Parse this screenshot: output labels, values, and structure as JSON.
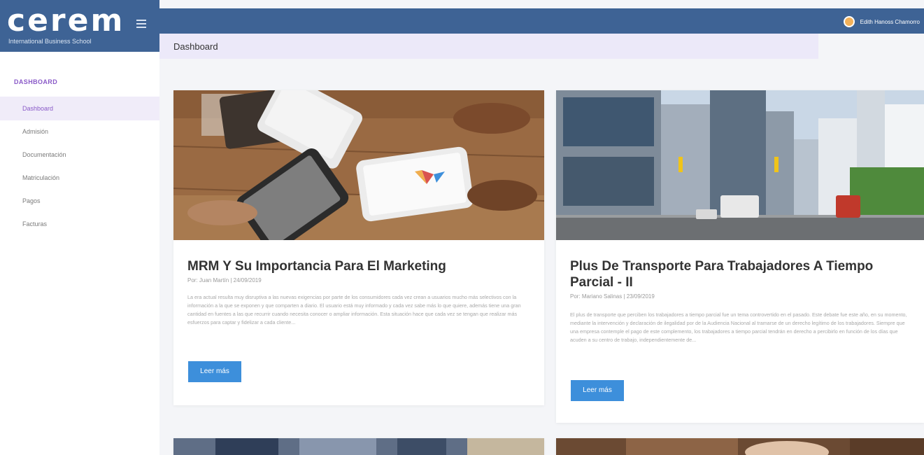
{
  "brand": {
    "name": "cerem",
    "subtitle": "International Business School"
  },
  "sidebar": {
    "section_title": "DASHBOARD",
    "items": [
      {
        "label": "Dashboard",
        "active": true
      },
      {
        "label": "Admisión",
        "active": false
      },
      {
        "label": "Documentación",
        "active": false
      },
      {
        "label": "Matriculación",
        "active": false
      },
      {
        "label": "Pagos",
        "active": false
      },
      {
        "label": "Facturas",
        "active": false
      }
    ]
  },
  "topbar": {
    "user_name": "Edith Hanoss Chamorro"
  },
  "page": {
    "title": "Dashboard"
  },
  "posts": [
    {
      "title": "MRM Y Su Importancia Para El Marketing",
      "meta": "Por: Juan Martín | 24/09/2019",
      "excerpt": "La era actual resulta muy disruptiva a las nuevas exigencias por parte de los consumidores cada vez crean a usuarios mucho más selectivos con la información a la que se exponen y que comparten a diario. El usuario está muy informado y cada vez sabe más lo que quiere, además tiene una gran cantidad en fuentes a las que recurrir cuando necesita conocer o ampliar información. Esta situación hace que cada vez se tengan que realizar más esfuerzos para captar y fidelizar a cada cliente...",
      "button": "Leer más"
    },
    {
      "title": "Plus De Transporte Para Trabajadores A Tiempo Parcial - II",
      "meta": "Por: Mariano Salinas | 23/09/2019",
      "excerpt": "El plus de transporte que perciben los trabajadores a tiempo parcial fue un tema controvertido en el pasado. Este debate fue este año, en su momento, mediante la intervención y declaración de ilegalidad por de la Audiencia Nacional al tramarse de un derecho legítimo de los trabajadores. Siempre que una empresa contemple el pago de este complemento, los trabajadores a tiempo parcial tendrán en derecho a percibirlo en función de los días que acuden a su centro de trabajo, independientemente de...",
      "button": "Leer más"
    }
  ],
  "colors": {
    "header_blue": "#3e6395",
    "accent_purple": "#8a5ac8",
    "button_blue": "#3d8fdb"
  }
}
